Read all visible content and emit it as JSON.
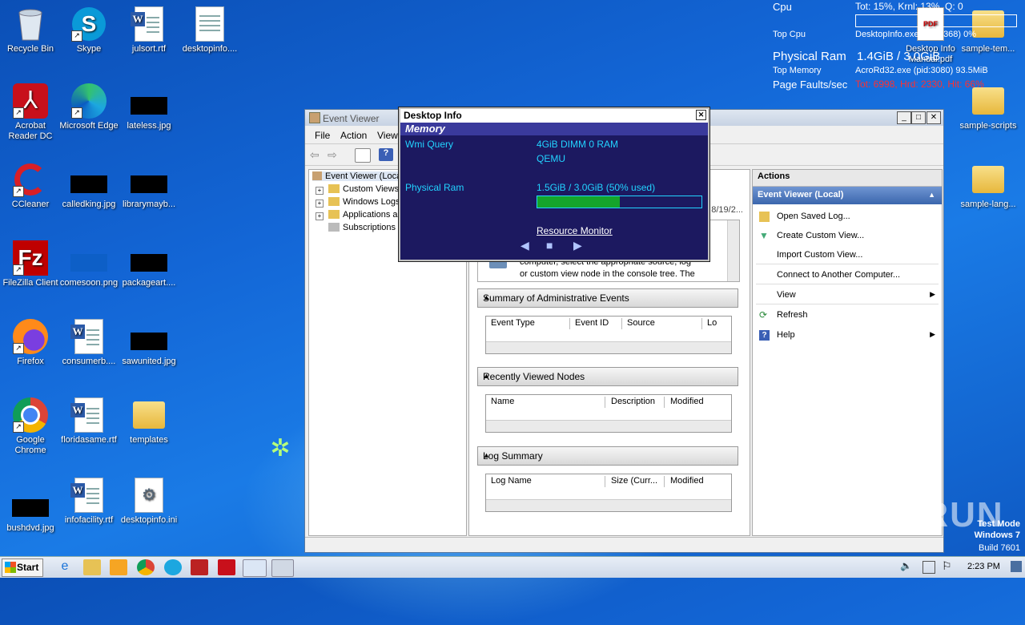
{
  "desktop": {
    "icons": [
      {
        "label": "Recycle Bin"
      },
      {
        "label": "Skype"
      },
      {
        "label": "julsort.rtf"
      },
      {
        "label": "desktopinfo...."
      },
      {
        "label": "Acrobat Reader DC"
      },
      {
        "label": "Microsoft Edge"
      },
      {
        "label": "lateless.jpg"
      },
      {
        "label": "CCleaner"
      },
      {
        "label": "calledking.jpg"
      },
      {
        "label": "librarymayb..."
      },
      {
        "label": "FileZilla Client"
      },
      {
        "label": "comesoon.png"
      },
      {
        "label": "packageart...."
      },
      {
        "label": "Firefox"
      },
      {
        "label": "consumerb...."
      },
      {
        "label": "sawunited.jpg"
      },
      {
        "label": "Google Chrome"
      },
      {
        "label": "floridasame.rtf"
      },
      {
        "label": "templates"
      },
      {
        "label": "bushdvd.jpg"
      },
      {
        "label": "infofacility.rtf"
      },
      {
        "label": "desktopinfo.ini"
      },
      {
        "label": "Desktop Info Manual.pdf"
      },
      {
        "label": "sample-tem..."
      },
      {
        "label": "sample-scripts"
      },
      {
        "label": "sample-lang..."
      }
    ]
  },
  "desktop_info_overlay": {
    "cpu_label": "Cpu",
    "cpu_value": "Tot: 15%, Krnl: 13%, Q: 0",
    "top_cpu_label": "Top Cpu",
    "top_cpu_value": "DesktopInfo.exe (pid:3368) 0%",
    "physical_ram_label": "Physical Ram",
    "physical_ram_value": "1.4GiB / 3.0GiB",
    "top_memory_label": "Top Memory",
    "top_memory_value": "AcroRd32.exe (pid:3080) 93.5MiB",
    "page_faults_label": "Page Faults/sec",
    "page_faults_value": "Tot: 6998, Hrd: 2330, Hit: 66%"
  },
  "event_viewer": {
    "title": "Event Viewer",
    "menu": [
      "File",
      "Action",
      "View"
    ],
    "tree": [
      "Event Viewer (Local)",
      "Custom Views",
      "Windows Logs",
      "Applications and Services Logs",
      "Subscriptions"
    ],
    "partial_date": "8/19/2...",
    "intro_text": [
      "computer, select the appropriate source, log",
      "or custom view node in the console tree. The"
    ],
    "panels": [
      {
        "title": "Summary of Administrative Events",
        "columns": [
          "Event Type",
          "Event ID",
          "Source",
          "Lo"
        ]
      },
      {
        "title": "Recently Viewed Nodes",
        "columns": [
          "Name",
          "Description",
          "Modified"
        ]
      },
      {
        "title": "Log Summary",
        "columns": [
          "Log Name",
          "Size (Curr...",
          "Modified"
        ]
      }
    ],
    "actions_header": "Actions",
    "actions_selected": "Event Viewer (Local)",
    "actions": [
      "Open Saved Log...",
      "Create Custom View...",
      "Import Custom View...",
      "Connect to Another Computer...",
      "View",
      "Refresh",
      "Help"
    ]
  },
  "desktop_info_window": {
    "title": "Desktop Info",
    "section": "Memory",
    "wmi_label": "Wmi Query",
    "wmi_value_1": "4GiB DIMM 0 RAM",
    "wmi_value_2": "QEMU",
    "ram_label": "Physical Ram",
    "ram_value": "1.5GiB / 3.0GiB (50% used)",
    "ram_used_fraction": 0.5,
    "link": "Resource Monitor",
    "nav_prev": "◀",
    "nav_stop": "■",
    "nav_next": "▶"
  },
  "taskbar": {
    "start_label": "Start",
    "clock": "2:23 PM"
  },
  "watermark": "ANY RUN",
  "test_mode": {
    "line1": "Test Mode",
    "line2": "Windows 7",
    "line3": "Build 7601"
  }
}
